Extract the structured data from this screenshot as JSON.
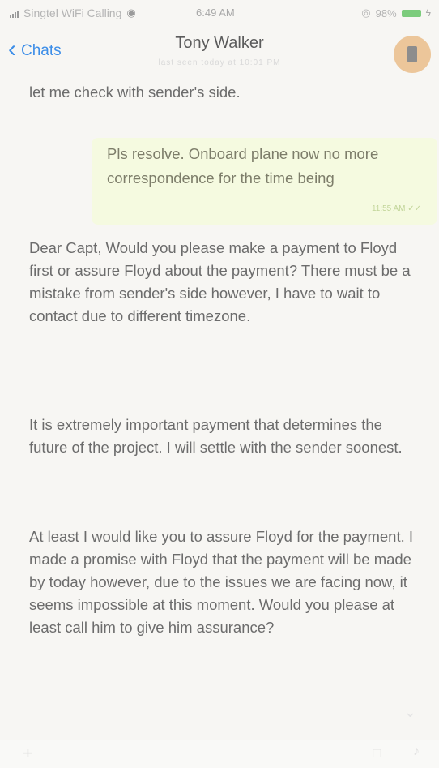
{
  "status_bar": {
    "carrier": "Singtel WiFi Calling",
    "time": "6:49 AM",
    "battery": "98%"
  },
  "nav": {
    "back_label": "Chats",
    "contact_name": "Tony Walker",
    "contact_subtitle": "last seen today at 10:01 PM"
  },
  "messages": [
    {
      "direction": "incoming",
      "text": "let me check with sender's side."
    },
    {
      "direction": "outgoing",
      "text": "Pls resolve. Onboard plane now no more correspondence for the time being",
      "time": "11:55 AM",
      "status": "✓✓"
    },
    {
      "direction": "incoming",
      "text": "Dear Capt, Would you please make a payment to Floyd first or assure Floyd about the payment? There must be a mistake from sender's side however, I have to wait to contact due to different timezone."
    },
    {
      "direction": "incoming",
      "text": "It is extremely important payment that determines the future of the project. I will settle with the sender soonest."
    },
    {
      "direction": "incoming",
      "text": "At least I would like you to assure Floyd for the payment. I made a promise with Floyd that the payment will be made by today however, due to the issues we are facing now, it seems impossible at this moment. Would you please at least call him to give him assurance?"
    }
  ],
  "icons": {
    "back": "chevron-left-icon",
    "scroll_down": "chevron-down-icon",
    "attach": "plus-icon",
    "camera": "camera-icon",
    "mic": "microphone-icon"
  },
  "colors": {
    "accent": "#3d8ee8",
    "outgoing_bubble": "#f5fae0",
    "background": "#f7f6f3",
    "battery": "#7ccc7c"
  }
}
